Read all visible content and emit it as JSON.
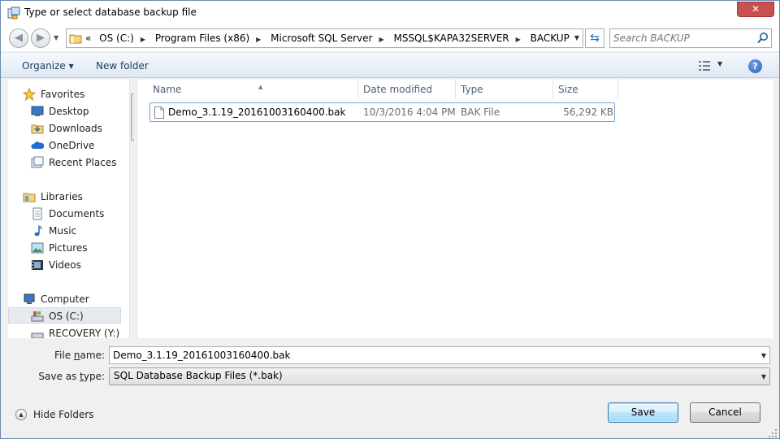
{
  "window": {
    "title": "Type or select database backup file",
    "close_label": "✕"
  },
  "address": {
    "overflow": "«",
    "crumbs": [
      "OS (C:)",
      "Program Files (x86)",
      "Microsoft SQL Server",
      "MSSQL$KAPA32SERVER",
      "BACKUP"
    ],
    "separator": "▶"
  },
  "search": {
    "placeholder": "Search BACKUP"
  },
  "toolbar": {
    "organize_label": "Organize ▾",
    "new_folder_label": "New folder",
    "help_label": "?"
  },
  "navigation": {
    "items": [
      {
        "label": "Favorites",
        "icon": "star-icon"
      },
      {
        "label": "Desktop",
        "icon": "desktop-icon"
      },
      {
        "label": "Downloads",
        "icon": "downloads-icon"
      },
      {
        "label": "OneDrive",
        "icon": "onedrive-icon"
      },
      {
        "label": "Recent Places",
        "icon": "recent-places-icon"
      },
      {
        "label": "Libraries",
        "icon": "libraries-icon"
      },
      {
        "label": "Documents",
        "icon": "documents-icon"
      },
      {
        "label": "Music",
        "icon": "music-icon"
      },
      {
        "label": "Pictures",
        "icon": "pictures-icon"
      },
      {
        "label": "Videos",
        "icon": "videos-icon"
      },
      {
        "label": "Computer",
        "icon": "computer-icon"
      },
      {
        "label": "OS (C:)",
        "icon": "drive-icon",
        "selected": true
      },
      {
        "label": "RECOVERY (Y:)",
        "icon": "drive-icon"
      }
    ]
  },
  "file_list": {
    "columns": [
      "Name",
      "Date modified",
      "Type",
      "Size"
    ],
    "sorted_column": "Name",
    "rows": [
      {
        "name": "Demo_3.1.19_20161003160400.bak",
        "date_modified": "10/3/2016 4:04 PM",
        "type": "BAK File",
        "size": "56,292 KB"
      }
    ]
  },
  "form": {
    "file_name_label_pre": "File ",
    "file_name_label_accel": "n",
    "file_name_label_post": "ame:",
    "file_name_value": "Demo_3.1.19_20161003160400.bak",
    "save_type_label_pre": "Save as ",
    "save_type_label_accel": "t",
    "save_type_label_post": "ype:",
    "save_type_value": "SQL Database Backup Files (*.bak)"
  },
  "footer": {
    "hide_folders_label": "Hide Folders",
    "save_label": "Save",
    "cancel_label": "Cancel"
  },
  "colors": {
    "accent": "#3c7fb1",
    "close_button": "#c75050",
    "selection_border": "#7da2ce"
  }
}
